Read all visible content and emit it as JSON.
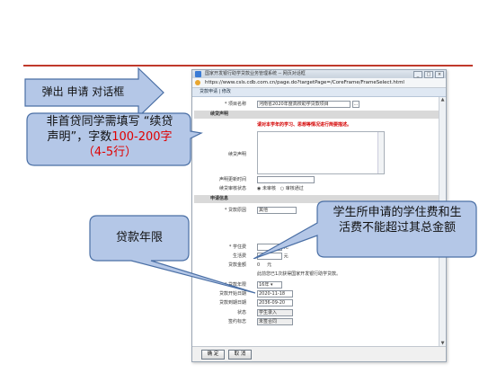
{
  "window": {
    "title": "国家开发银行助学贷款业务管理系统 -- 网页对话框",
    "url": "https://www.csls.cdb.com.cn/page.do?targetPage=/CoreFrame/FrameSelect.html",
    "tab_label": "贷款申请 | 修改"
  },
  "form": {
    "project_label": "* 项目名称",
    "project_value": "河南省2020年度高校助学贷款项目",
    "project_button": "...",
    "section_continuation": "续贷声明",
    "notice": "请对本学年的学习、思想等情况进行简要描述。",
    "continuation_label": "续贷声明",
    "update_time_label": "声明更新时间",
    "review_status_label": "续贷审核状态",
    "review_options": [
      "未审核",
      "审核通过"
    ],
    "section_apply": "申请信息",
    "reason_label": "* 贷款原因",
    "reason_value": "其他",
    "tuition_label": "* 学住费",
    "tuition_unit": "元",
    "living_label": "生活费",
    "living_unit": "元",
    "amount_label": "贷款金额",
    "amount_value": "0",
    "amount_unit": "元",
    "first_loan_note": "此前您已1次获得国家开发银行助学贷款。",
    "years_label": "* 贷款年限",
    "years_value": "16年",
    "start_label": "贷款开始日期",
    "start_value": "2020-11-18",
    "end_label": "贷款到期日期",
    "end_value": "2036-09-20",
    "status_label": "状态",
    "status_value": "学生录入",
    "contract_label": "签约标志",
    "contract_value": "未签合同"
  },
  "footer": {
    "confirm": "确 定",
    "cancel": "取 消"
  },
  "callouts": {
    "popup": "弹出 申请 对话框",
    "statement_line1": "非首贷同学需填写 “续贷",
    "statement_line2_a": "声明”，字数",
    "statement_line2_b": "100-200字",
    "statement_line3": "（4-5行）",
    "limit_line1": "学生所申请的学住费和生",
    "limit_line2": "活费不能超过其总金额",
    "years": "贷款年限"
  },
  "colors": {
    "accent_red": "#e00000",
    "callout_fill": "#b4c7e7",
    "callout_stroke": "#4a6fa5"
  }
}
